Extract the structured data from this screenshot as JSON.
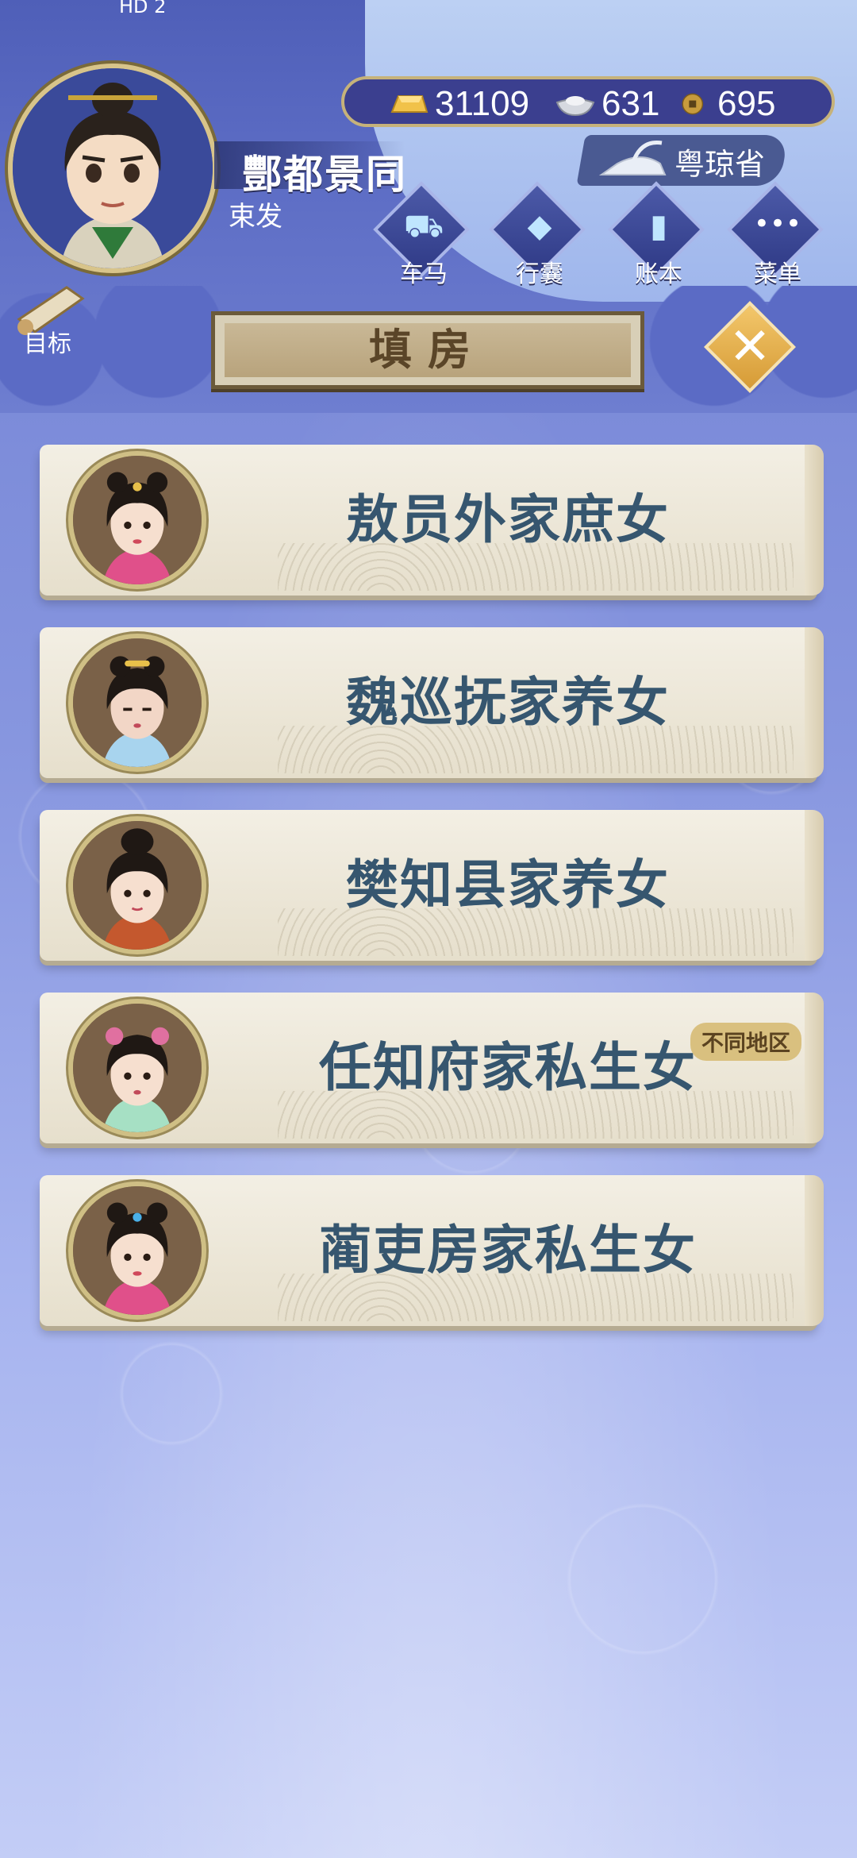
{
  "status": {
    "left": "HD 2",
    "right": ""
  },
  "player": {
    "name": "酆都景同",
    "title": "束发"
  },
  "currency": {
    "gold": "31109",
    "silver": "631",
    "coin": "695"
  },
  "location": {
    "province": "粤琼省"
  },
  "menu": [
    {
      "label": "车马",
      "icon": "carriage-icon"
    },
    {
      "label": "行囊",
      "icon": "bag-icon"
    },
    {
      "label": "账本",
      "icon": "ledger-icon"
    },
    {
      "label": "菜单",
      "icon": "more-icon"
    }
  ],
  "goal": {
    "label": "目标"
  },
  "header": {
    "title": "填房"
  },
  "candidates": [
    {
      "name": "敖员外家庶女",
      "tag": ""
    },
    {
      "name": "魏巡抚家养女",
      "tag": ""
    },
    {
      "name": "樊知县家养女",
      "tag": ""
    },
    {
      "name": "任知府家私生女",
      "tag": "不同地区"
    },
    {
      "name": "蔺吏房家私生女",
      "tag": ""
    }
  ],
  "colors": {
    "card_text": "#36566f",
    "accent_gold": "#d69b36",
    "header_brown": "#5a4528"
  }
}
